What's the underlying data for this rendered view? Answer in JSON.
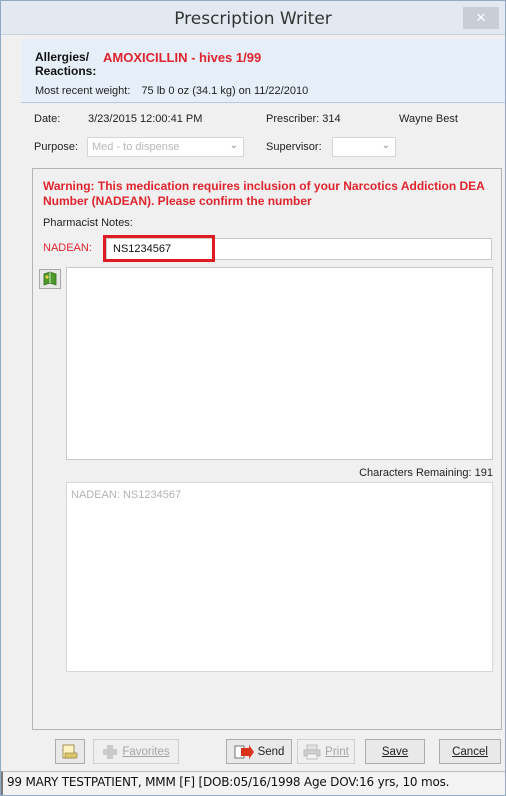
{
  "window": {
    "title": "Prescription Writer",
    "close_label": "✕"
  },
  "allergy": {
    "label": "Allergies/ Reactions:",
    "value": "AMOXICILLIN  - hives  1/99",
    "weight_label": "Most recent weight:",
    "weight_value": "75 lb 0 oz (34.1 kg) on 11/22/2010"
  },
  "header": {
    "date_label": "Date:",
    "date_value": "3/23/2015 12:00:41 PM",
    "prescriber_label": "Prescriber: 314",
    "prescriber_name": "Wayne Best",
    "purpose_label": "Purpose:",
    "purpose_value": "Med - to dispense",
    "supervisor_label": "Supervisor:",
    "supervisor_value": ""
  },
  "form": {
    "warning": "Warning: This medication requires inclusion of your Narcotics Addiction DEA Number (NADEAN). Please confirm the number",
    "pharmacist_notes_label": "Pharmacist Notes:",
    "nadean_label": "NADEAN:",
    "nadean_value": "NS1234567",
    "notes_value": "",
    "chars_remaining": "Characters Remaining: 191",
    "preview_text": "NADEAN:  NS1234567"
  },
  "toolbar": {
    "favorites_label": "Favorites",
    "send_label": "Send",
    "print_label": "Print",
    "save_label": "Save",
    "cancel_label": "Cancel"
  },
  "status": {
    "text": "99 MARY TESTPATIENT, MMM [F] [DOB:05/16/1998  Age DOV:16 yrs, 10 mos."
  },
  "colors": {
    "warning": "#e0242e",
    "highlight": "#e01a22",
    "panel": "#e6eff8"
  },
  "icons": {
    "book": "book-icon",
    "rx_note": "rx-note-icon",
    "favorites": "favorites-add-icon",
    "send": "send-arrow-icon",
    "print": "printer-icon"
  }
}
